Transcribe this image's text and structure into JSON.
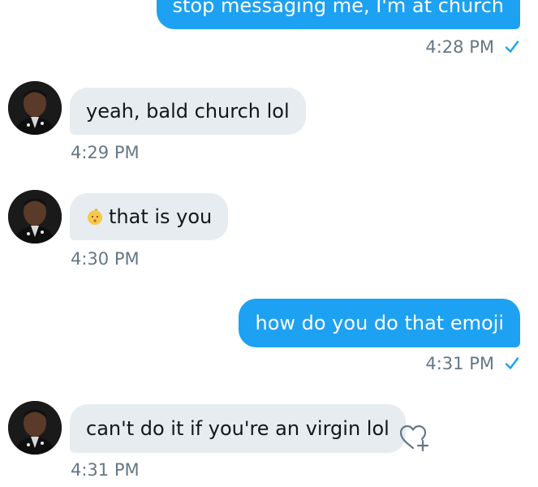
{
  "messages": [
    {
      "text": "stop messaging me, I'm at church",
      "time": "4:28 PM",
      "direction": "outgoing",
      "read_icon": "check-icon"
    },
    {
      "text": "yeah, bald church lol",
      "time": "4:29 PM",
      "direction": "incoming"
    },
    {
      "emoji": "baby-face-emoji",
      "text": "that is you",
      "time": "4:30 PM",
      "direction": "incoming"
    },
    {
      "text": "how do you do that emoji",
      "time": "4:31 PM",
      "direction": "outgoing",
      "read_icon": "check-icon"
    },
    {
      "text": "can't do it if you're an virgin lol",
      "time": "4:31 PM",
      "direction": "incoming",
      "action_icon": "heart-plus-icon"
    }
  ],
  "colors": {
    "outgoing_bubble": "#1da1f2",
    "incoming_bubble": "#e6ecf0",
    "timestamp": "#657786",
    "check": "#1da1f2"
  }
}
